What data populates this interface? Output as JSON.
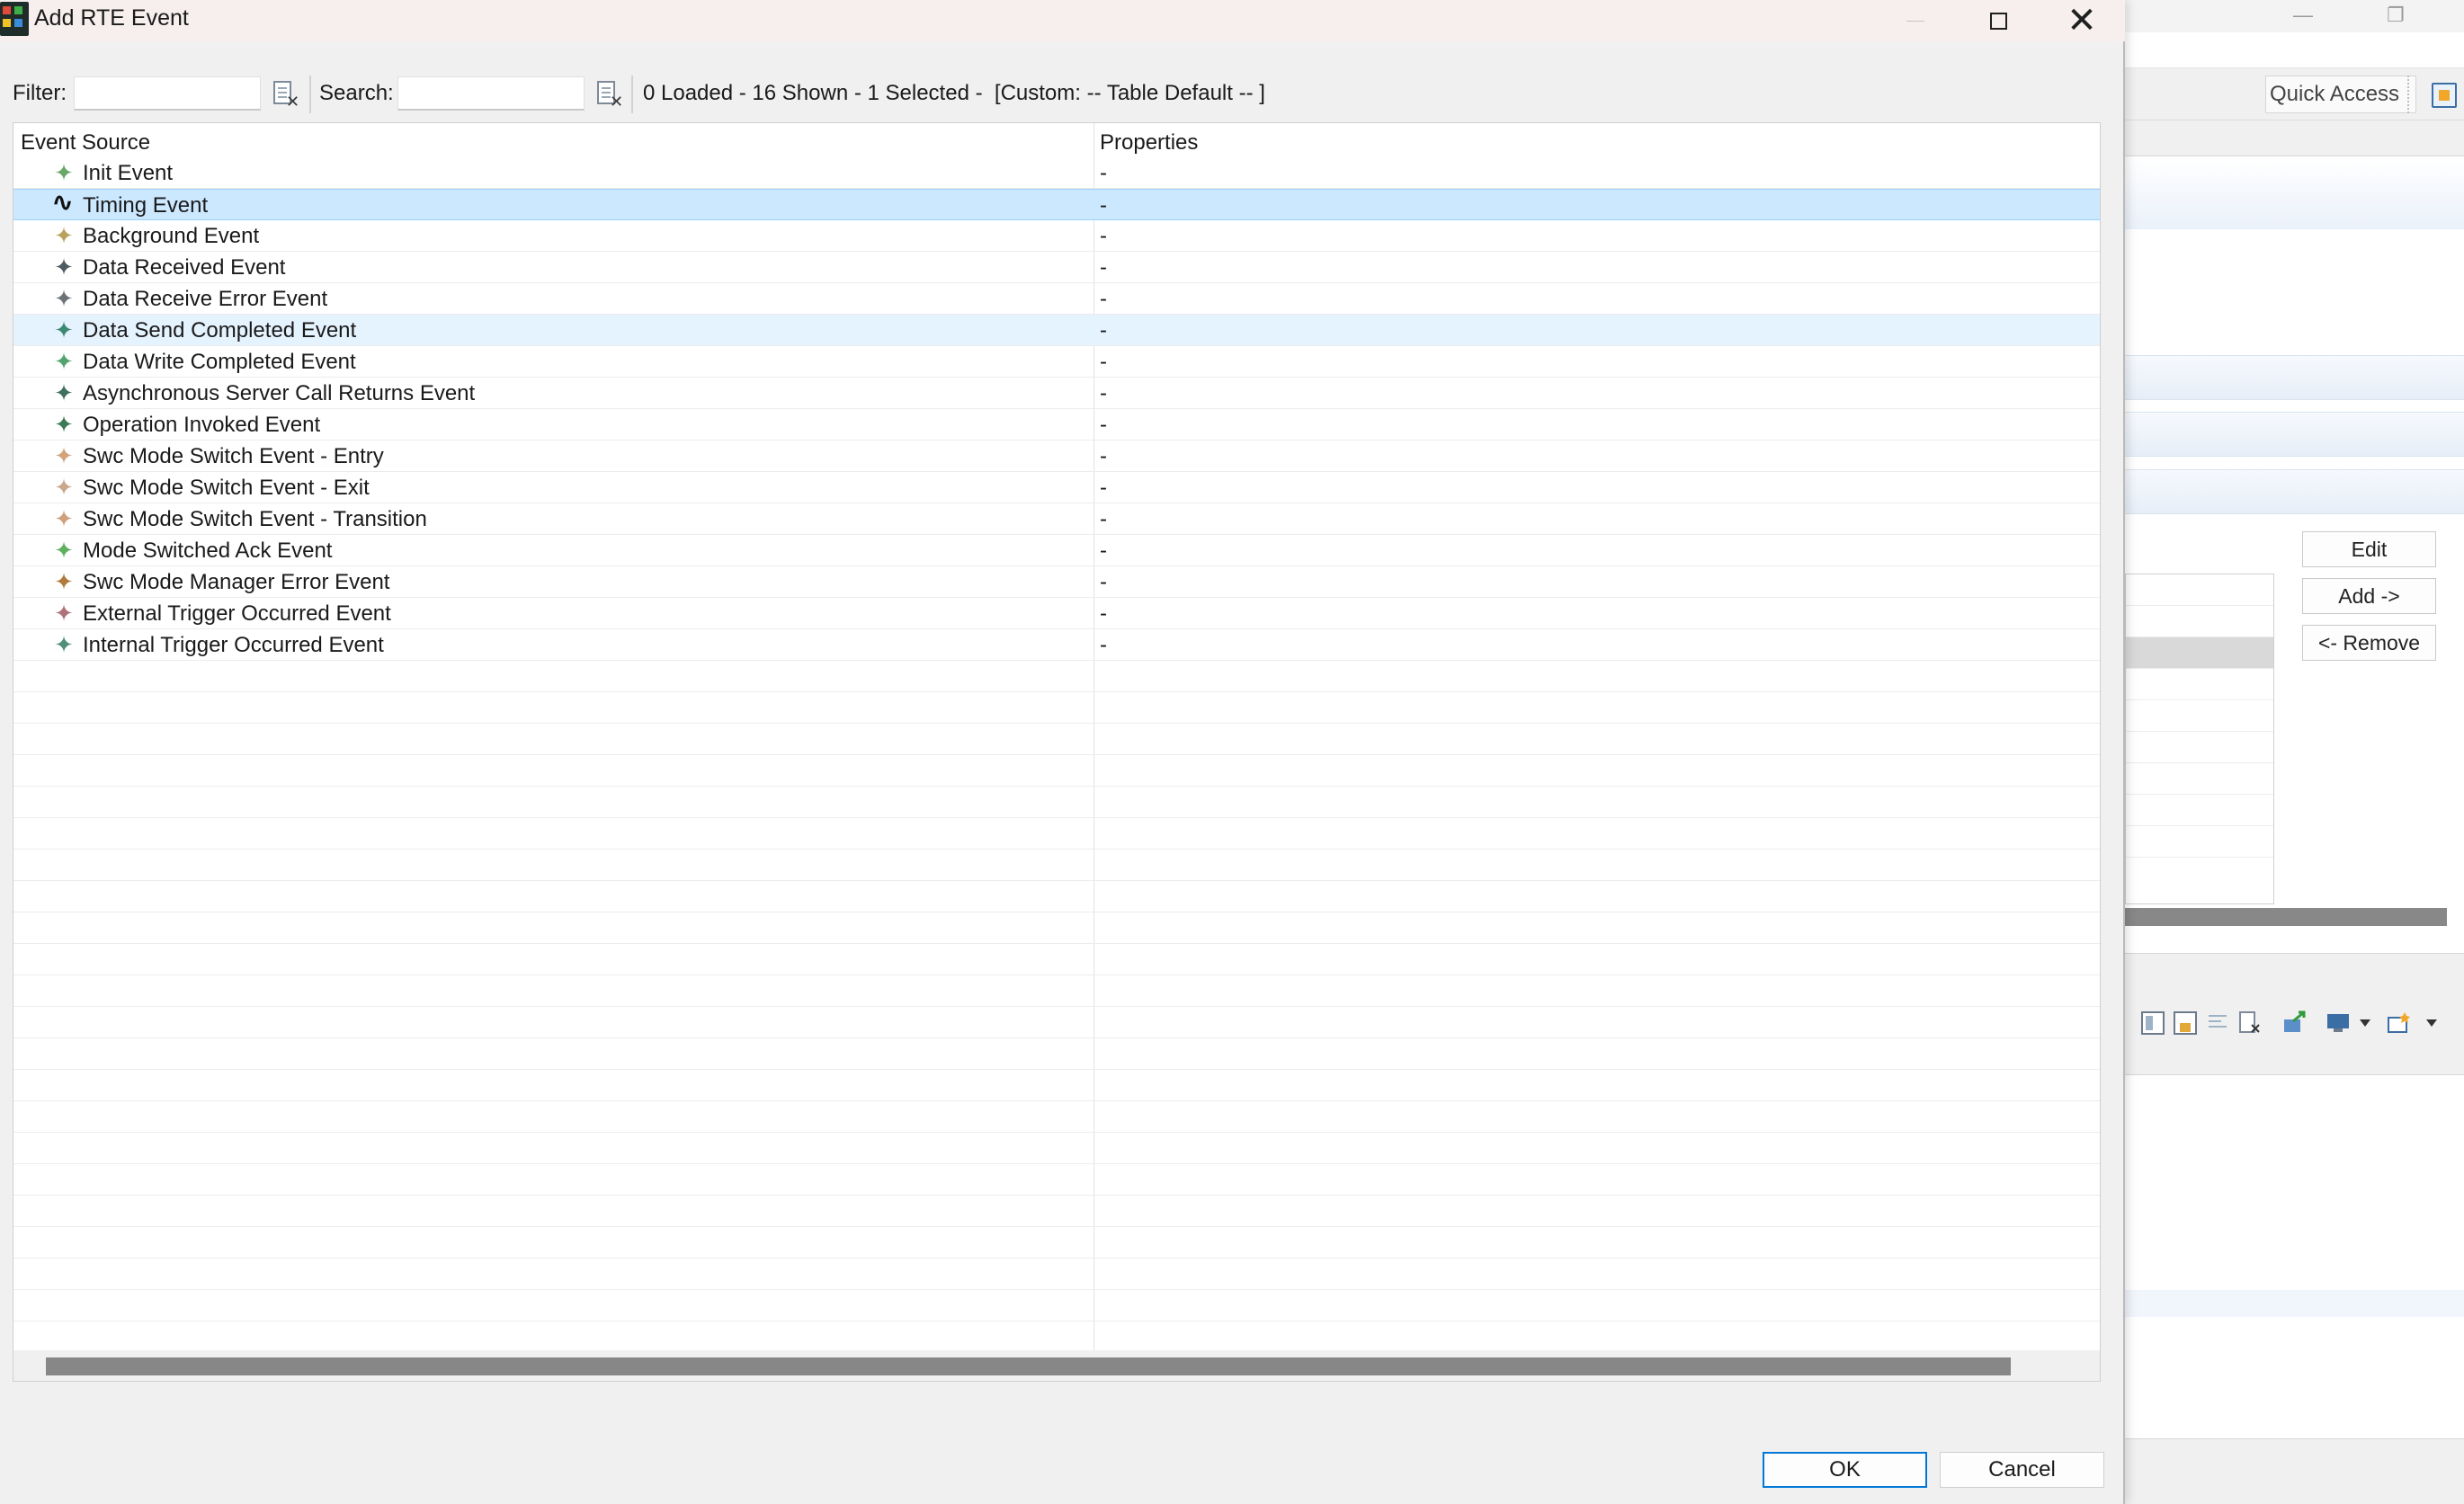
{
  "dialog": {
    "title": "Add RTE Event",
    "controls": {
      "minimize": "—",
      "maximize": "□",
      "close": "✕"
    }
  },
  "filterbar": {
    "filter_label": "Filter:",
    "filter_value": "",
    "search_label": "Search:",
    "search_value": "",
    "status": "0 Loaded - 16 Shown - 1 Selected -  [Custom: -- Table Default -- ]"
  },
  "table": {
    "columns": [
      "Event Source",
      "Properties"
    ],
    "rows": [
      {
        "source": "Init Event",
        "properties": "-",
        "icon": "sparkle-icon",
        "color": "#6aa86a"
      },
      {
        "source": "Timing Event",
        "properties": "-",
        "icon": "wave-icon",
        "color": "#111111"
      },
      {
        "source": "Background Event",
        "properties": "-",
        "icon": "sparkle-icon",
        "color": "#b9a25b"
      },
      {
        "source": "Data Received Event",
        "properties": "-",
        "icon": "sparkle-icon",
        "color": "#4f5b60"
      },
      {
        "source": "Data Receive Error Event",
        "properties": "-",
        "icon": "sparkle-icon",
        "color": "#6b7278"
      },
      {
        "source": "Data Send Completed Event",
        "properties": "-",
        "icon": "sparkle-icon",
        "color": "#3d8a74"
      },
      {
        "source": "Data Write Completed Event",
        "properties": "-",
        "icon": "sparkle-icon",
        "color": "#52a36e"
      },
      {
        "source": "Asynchronous Server Call Returns Event",
        "properties": "-",
        "icon": "sparkle-icon",
        "color": "#3f6e63"
      },
      {
        "source": "Operation Invoked Event",
        "properties": "-",
        "icon": "sparkle-icon",
        "color": "#3c7a55"
      },
      {
        "source": "Swc Mode Switch Event - Entry",
        "properties": "-",
        "icon": "sparkle-icon",
        "color": "#d3a37a"
      },
      {
        "source": "Swc Mode Switch Event - Exit",
        "properties": "-",
        "icon": "sparkle-icon",
        "color": "#c9a88c"
      },
      {
        "source": "Swc Mode Switch Event - Transition",
        "properties": "-",
        "icon": "sparkle-icon",
        "color": "#cfa07d"
      },
      {
        "source": "Mode Switched Ack Event",
        "properties": "-",
        "icon": "sparkle-icon",
        "color": "#5fb05f"
      },
      {
        "source": "Swc Mode Manager Error Event",
        "properties": "-",
        "icon": "sparkle-icon",
        "color": "#b07a3c"
      },
      {
        "source": "External Trigger Occurred Event",
        "properties": "-",
        "icon": "sparkle-icon",
        "color": "#b0707a"
      },
      {
        "source": "Internal Trigger Occurred Event",
        "properties": "-",
        "icon": "sparkle-icon",
        "color": "#4f8f77"
      }
    ],
    "selected_index": 1,
    "hover_index": 5
  },
  "buttons": {
    "ok": "OK",
    "cancel": "Cancel"
  },
  "background_app": {
    "quick_access": "Quick Access",
    "side_buttons": [
      "Edit",
      "Add ->",
      "<- Remove"
    ],
    "window_controls": {
      "minimize": "—",
      "restore": "❐"
    }
  },
  "colors": {
    "selection": "#cce8ff",
    "selection_border": "#99d1ff",
    "hover": "#e5f3ff",
    "ok_border": "#0078d7"
  }
}
